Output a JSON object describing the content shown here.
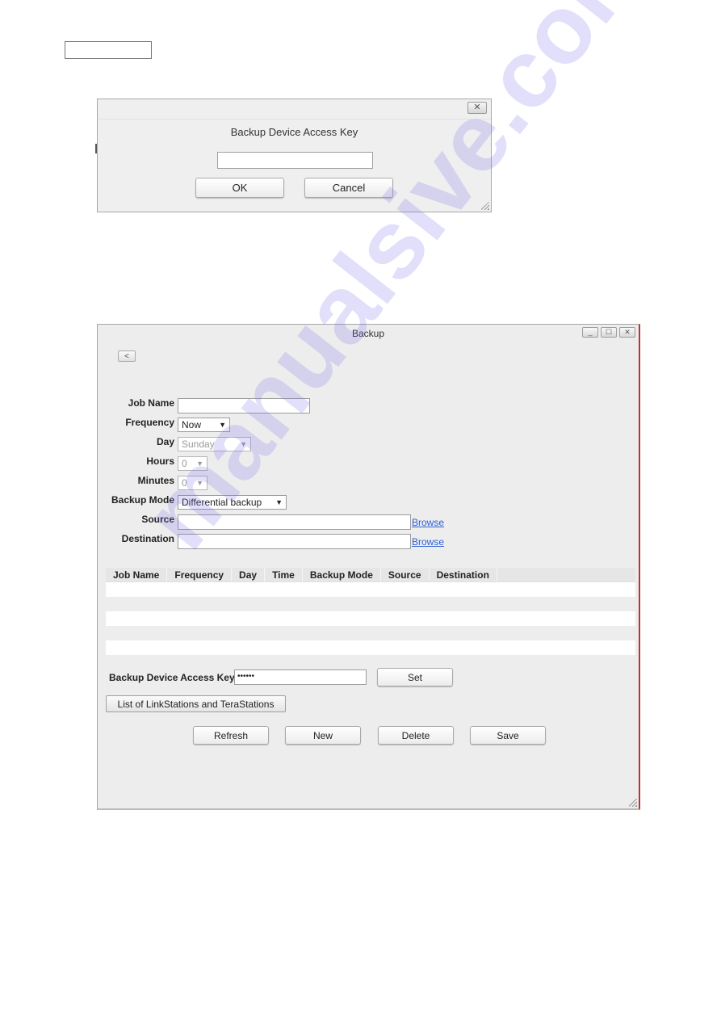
{
  "dialog": {
    "title": "Backup Device Access Key",
    "input_value": "",
    "ok_label": "OK",
    "cancel_label": "Cancel",
    "close_glyph": "✕"
  },
  "window": {
    "title": "Backup",
    "minimize_glyph": "_",
    "maximize_glyph": "☐",
    "close_glyph": "✕",
    "back_glyph": "<",
    "form": {
      "job_name_label": "Job Name",
      "job_name_value": "",
      "frequency_label": "Frequency",
      "frequency_value": "Now",
      "day_label": "Day",
      "day_value": "Sunday",
      "hours_label": "Hours",
      "hours_value": "0",
      "minutes_label": "Minutes",
      "minutes_value": "0",
      "backup_mode_label": "Backup Mode",
      "backup_mode_value": "Differential backup",
      "source_label": "Source",
      "source_value": "",
      "destination_label": "Destination",
      "destination_value": "",
      "browse_label": "Browse"
    },
    "table": {
      "columns": [
        "Job Name",
        "Frequency",
        "Day",
        "Time",
        "Backup Mode",
        "Source",
        "Destination"
      ],
      "rows": []
    },
    "access_key": {
      "label": "Backup Device Access Key",
      "value": "••••••",
      "set_label": "Set"
    },
    "list_button_label": "List of LinkStations and TeraStations",
    "actions": {
      "refresh": "Refresh",
      "new": "New",
      "delete": "Delete",
      "save": "Save"
    }
  },
  "watermark": "manualsive.com",
  "arrow_glyph": "▼"
}
